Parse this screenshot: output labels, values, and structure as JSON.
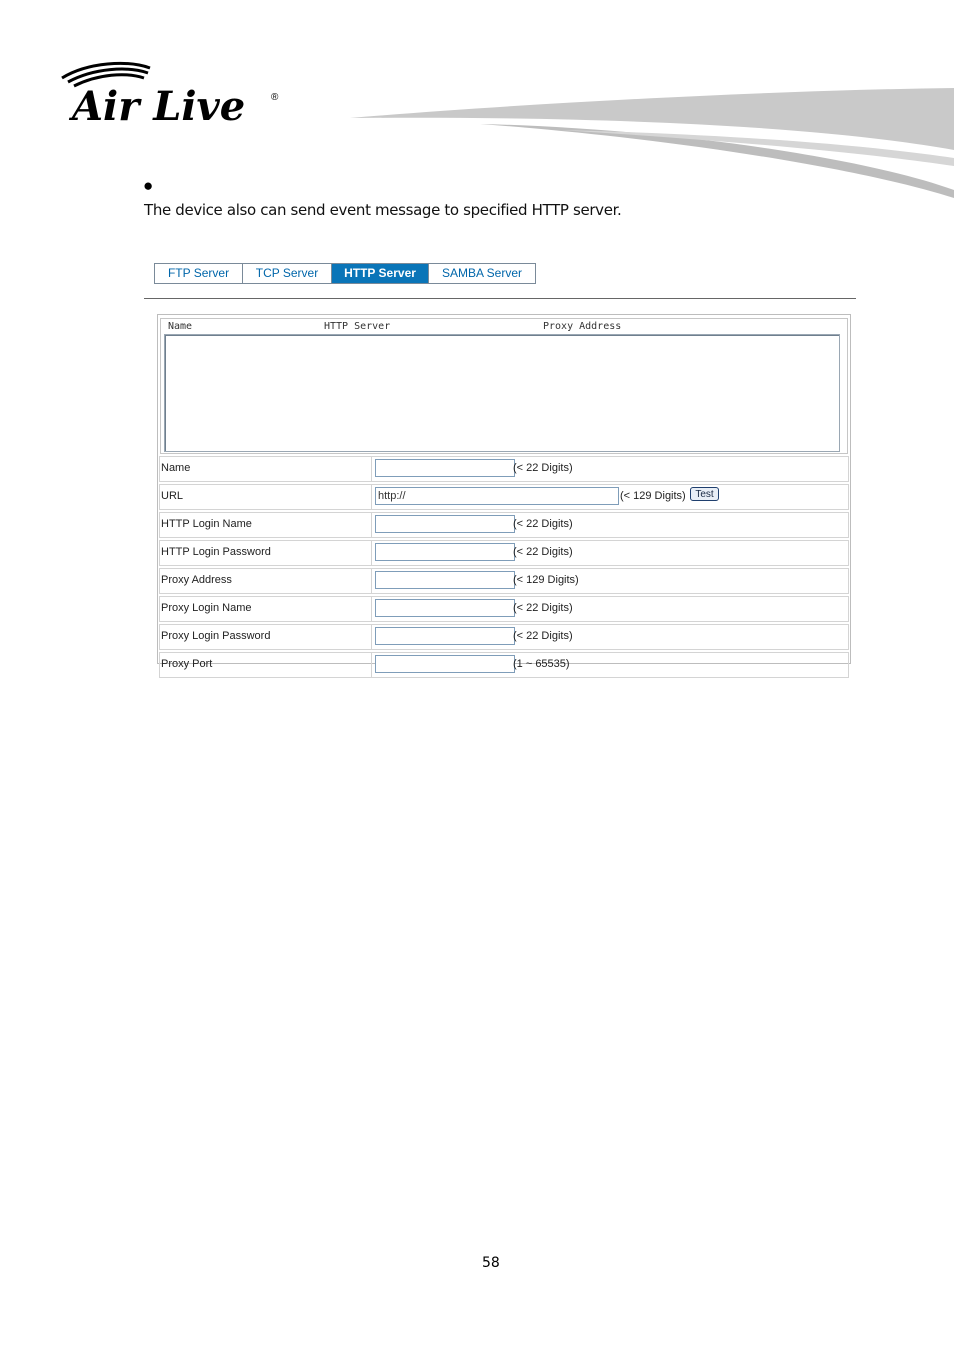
{
  "header": {
    "logo_text": "Air Live"
  },
  "intro": {
    "bullet": "●",
    "text": "The device also can send event message to specified HTTP server."
  },
  "tabs": [
    {
      "label": "FTP Server",
      "active": false
    },
    {
      "label": "TCP Server",
      "active": false
    },
    {
      "label": "HTTP Server",
      "active": true
    },
    {
      "label": "SAMBA Server",
      "active": false
    }
  ],
  "server_list": {
    "columns": [
      "Name",
      "HTTP Server",
      "Proxy Address"
    ]
  },
  "form": {
    "name": {
      "label": "Name",
      "value": "",
      "hint": "(< 22 Digits)"
    },
    "url": {
      "label": "URL",
      "value": "http://",
      "hint": "(< 129 Digits)",
      "test_label": "Test"
    },
    "http_login_name": {
      "label": "HTTP Login Name",
      "value": "",
      "hint": "(< 22 Digits)"
    },
    "http_login_password": {
      "label": "HTTP Login Password",
      "value": "",
      "hint": "(< 22 Digits)"
    },
    "proxy_address": {
      "label": "Proxy Address",
      "value": "",
      "hint": "(< 129 Digits)"
    },
    "proxy_login_name": {
      "label": "Proxy Login Name",
      "value": "",
      "hint": "(< 22 Digits)"
    },
    "proxy_login_password": {
      "label": "Proxy Login Password",
      "value": "",
      "hint": "(< 22 Digits)"
    },
    "proxy_port": {
      "label": "Proxy Port",
      "value": "",
      "hint": "(1 ~ 65535)"
    }
  },
  "footer": {
    "page_number": "58"
  },
  "colors": {
    "tab_active": "#0a75b8",
    "tab_text": "#0066aa",
    "input_border": "#7f9db9"
  }
}
